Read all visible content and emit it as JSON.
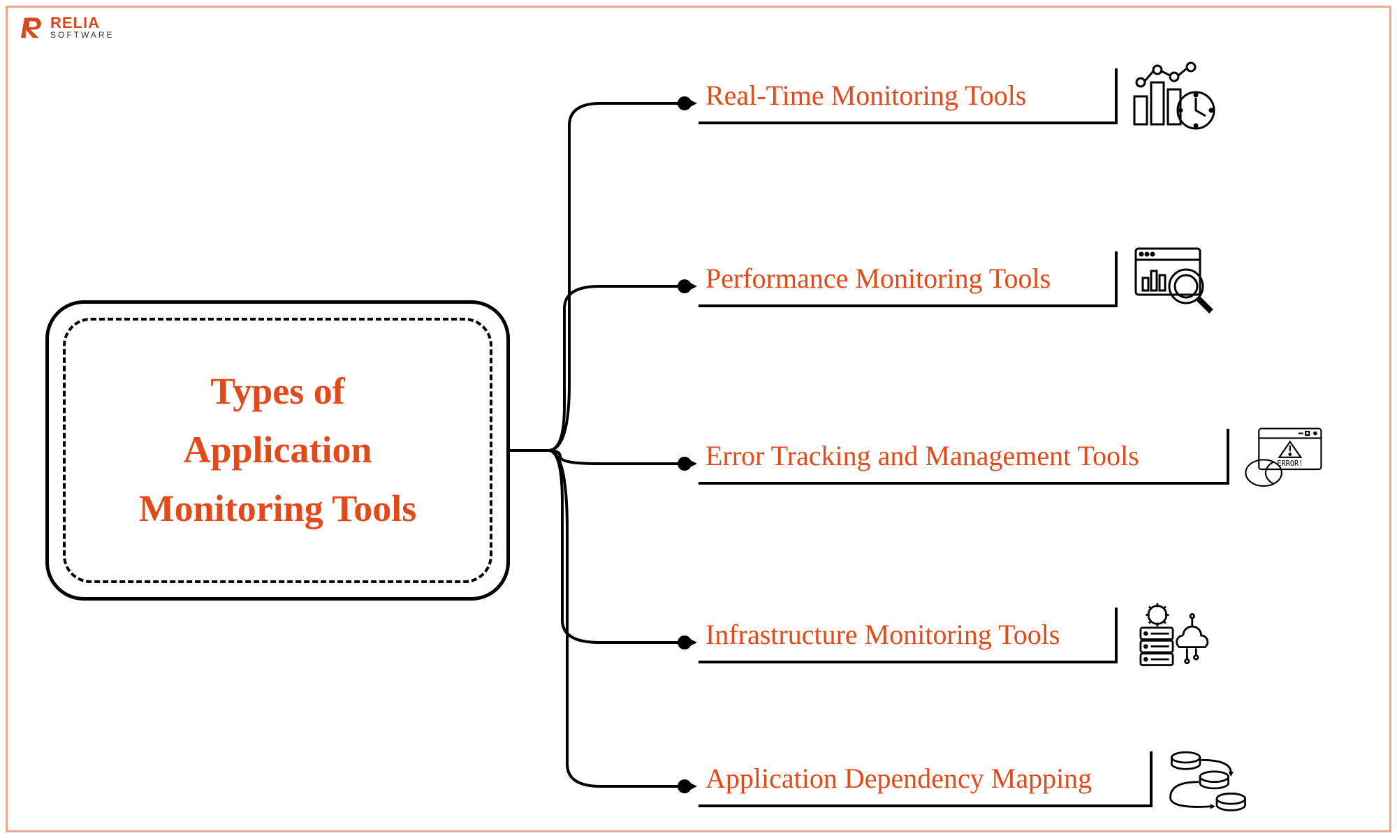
{
  "brand": {
    "name_top": "RELIA",
    "name_bottom": "SOFTWARE"
  },
  "main": {
    "title": "Types of\nApplication\nMonitoring Tools"
  },
  "items": [
    {
      "label": "Real-Time Monitoring Tools",
      "icon": "chart-clock-icon"
    },
    {
      "label": "Performance Monitoring Tools",
      "icon": "magnifier-dashboard-icon"
    },
    {
      "label": "Error Tracking and Management Tools",
      "icon": "error-window-icon"
    },
    {
      "label": "Infrastructure Monitoring Tools",
      "icon": "server-cloud-gear-icon"
    },
    {
      "label": "Application Dependency Mapping",
      "icon": "dependency-cylinders-icon"
    }
  ],
  "colors": {
    "accent": "#e24a1a",
    "frame": "#f0a88a",
    "line": "#000000"
  }
}
